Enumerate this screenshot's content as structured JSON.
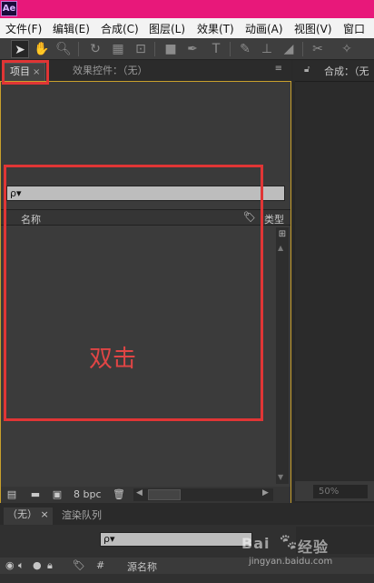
{
  "app": {
    "logo_text": "Ae"
  },
  "menu": {
    "items": [
      "文件(F)",
      "编辑(E)",
      "合成(C)",
      "图层(L)",
      "效果(T)",
      "动画(A)",
      "视图(V)",
      "窗口"
    ]
  },
  "toolbar": {
    "tools": [
      "selection-tool",
      "hand-tool",
      "zoom-tool",
      "rotate-tool",
      "camera-tool",
      "pan-behind-tool",
      "rectangle-tool",
      "pen-tool",
      "type-tool",
      "brush-tool",
      "clone-stamp-tool",
      "eraser-tool",
      "roto-brush-tool",
      "puppet-pin-tool"
    ]
  },
  "project_panel": {
    "tab_label": "项目",
    "tab_close": "×",
    "effects_tab_label": "效果控件：（无）",
    "panel_menu_icon": "≡",
    "search_placeholder": "ρ▾",
    "col_name": "名称",
    "col_type": "类型",
    "footer_bpc": "8 bpc"
  },
  "annotation": {
    "text": "双击",
    "color": "#e03535"
  },
  "composition_panel": {
    "tab_label": "合成：（无",
    "zoom": "50%"
  },
  "timeline": {
    "tab_label": "（无）",
    "tab_close": "×",
    "render_queue_label": "渲染队列",
    "search_placeholder": "ρ▾",
    "col_num": "#",
    "col_source_name": "源名称"
  },
  "watermark": {
    "logo": "Bai",
    "paw": "🐾",
    "suffix": "经验",
    "url": "jingyan.baidu.com"
  },
  "colors": {
    "titlebar": "#e8187a",
    "panel_border_active": "#c8a02c",
    "annotation_red": "#e03535"
  }
}
